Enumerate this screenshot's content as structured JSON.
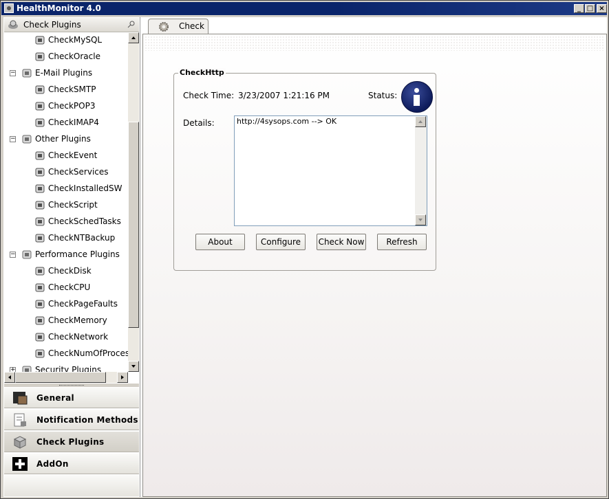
{
  "window": {
    "title": "HealthMonitor 4.0"
  },
  "left_header": {
    "title": "Check Plugins"
  },
  "tree": [
    {
      "label": "CheckMySQL",
      "level": 1,
      "icon": "mysql-icon"
    },
    {
      "label": "CheckOracle",
      "level": 1,
      "icon": "oracle-icon"
    },
    {
      "label": "E-Mail Plugins",
      "level": 0,
      "icon": "email-icon",
      "expanded": true
    },
    {
      "label": "CheckSMTP",
      "level": 1,
      "icon": "smtp-icon"
    },
    {
      "label": "CheckPOP3",
      "level": 1,
      "icon": "pop3-icon"
    },
    {
      "label": "CheckIMAP4",
      "level": 1,
      "icon": "imap4-icon"
    },
    {
      "label": "Other Plugins",
      "level": 0,
      "icon": "brush-icon",
      "expanded": true
    },
    {
      "label": "CheckEvent",
      "level": 1,
      "icon": "event-icon"
    },
    {
      "label": "CheckServices",
      "level": 1,
      "icon": "services-icon"
    },
    {
      "label": "CheckInstalledSW",
      "level": 1,
      "icon": "installed-sw-icon"
    },
    {
      "label": "CheckScript",
      "level": 1,
      "icon": "script-icon"
    },
    {
      "label": "CheckSchedTasks",
      "level": 1,
      "icon": "tasks-icon"
    },
    {
      "label": "CheckNTBackup",
      "level": 1,
      "icon": "backup-icon"
    },
    {
      "label": "Performance Plugins",
      "level": 0,
      "icon": "performance-icon",
      "expanded": true
    },
    {
      "label": "CheckDisk",
      "level": 1,
      "icon": "disk-icon"
    },
    {
      "label": "CheckCPU",
      "level": 1,
      "icon": "cpu-icon"
    },
    {
      "label": "CheckPageFaults",
      "level": 1,
      "icon": "pagefaults-icon"
    },
    {
      "label": "CheckMemory",
      "level": 1,
      "icon": "memory-icon"
    },
    {
      "label": "CheckNetwork",
      "level": 1,
      "icon": "network-icon"
    },
    {
      "label": "CheckNumOfProcesses",
      "level": 1,
      "icon": "processes-icon"
    },
    {
      "label": "Security Plugins",
      "level": 0,
      "icon": "security-icon",
      "expanded": false
    }
  ],
  "nav": [
    {
      "label": "General",
      "icon": "general-icon"
    },
    {
      "label": "Notification Methods",
      "icon": "notification-icon"
    },
    {
      "label": "Check Plugins",
      "icon": "plugins-box-icon",
      "active": true
    },
    {
      "label": "AddOn",
      "icon": "plus-icon"
    }
  ],
  "tab": {
    "label": "Check"
  },
  "group": {
    "title": "CheckHttp",
    "check_time_label": "Check Time:",
    "check_time_value": "3/23/2007 1:21:16 PM",
    "status_label": "Status:",
    "status_icon": "info-icon",
    "details_label": "Details:",
    "details_text": "http://4sysops.com --> OK"
  },
  "buttons": {
    "about": "About",
    "configure": "Configure",
    "check_now": "Check Now",
    "refresh": "Refresh"
  },
  "colors": {
    "titlebar": "#0a246a",
    "status_icon": "#1a2a6c"
  }
}
